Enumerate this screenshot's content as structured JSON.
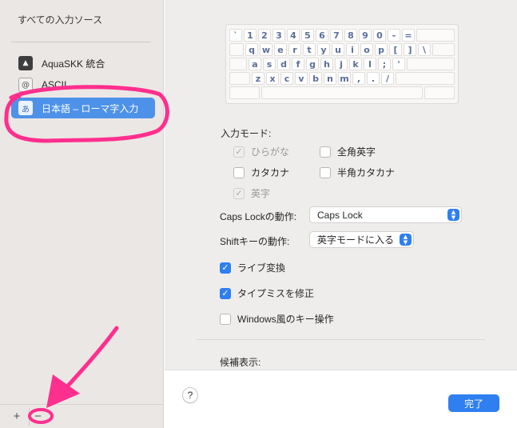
{
  "sidebar": {
    "title": "すべての入力ソース",
    "items": [
      {
        "label": "AquaSKK 統合",
        "icon": "aquaskk-icon",
        "glyph": "▲"
      },
      {
        "label": "ASCII",
        "icon": "ascii-icon",
        "glyph": "@"
      },
      {
        "label": "日本語 – ローマ字入力",
        "icon": "hiragana-a-icon",
        "glyph": "あ",
        "selected": true
      }
    ],
    "add_label": "+",
    "remove_label": "−"
  },
  "keyboard": {
    "rows": [
      [
        "`",
        "1",
        "2",
        "3",
        "4",
        "5",
        "6",
        "7",
        "8",
        "9",
        "0",
        "-",
        "="
      ],
      [
        "q",
        "w",
        "e",
        "r",
        "t",
        "y",
        "u",
        "i",
        "o",
        "p",
        "[",
        "]",
        "\\"
      ],
      [
        "a",
        "s",
        "d",
        "f",
        "g",
        "h",
        "j",
        "k",
        "l",
        ";",
        "'"
      ],
      [
        "z",
        "x",
        "c",
        "v",
        "b",
        "n",
        "m",
        ",",
        ".",
        "/"
      ]
    ]
  },
  "input_mode": {
    "label": "入力モード:",
    "options": {
      "hiragana": {
        "label": "ひらがな",
        "checked": true,
        "disabled": true
      },
      "zenkaku_eiji": {
        "label": "全角英字",
        "checked": false
      },
      "katakana": {
        "label": "カタカナ",
        "checked": false
      },
      "hankaku_katakana": {
        "label": "半角カタカナ",
        "checked": false
      },
      "eiji": {
        "label": "英字",
        "checked": true,
        "disabled": true
      }
    }
  },
  "caps_lock": {
    "label": "Caps Lockの動作:",
    "value": "Caps Lock"
  },
  "shift_key": {
    "label": "Shiftキーの動作:",
    "value": "英字モードに入る"
  },
  "live_conversion": {
    "label": "ライブ変換",
    "checked": true
  },
  "typo_correction": {
    "label": "タイプミスを修正",
    "checked": true
  },
  "windows_keys": {
    "label": "Windows風のキー操作",
    "checked": false
  },
  "candidates": {
    "label": "候補表示:"
  },
  "footer": {
    "help_label": "?",
    "done_label": "完了"
  },
  "colors": {
    "accent": "#2f7ff0",
    "selection": "#4d92e8",
    "annotation": "#ff2f8e"
  }
}
